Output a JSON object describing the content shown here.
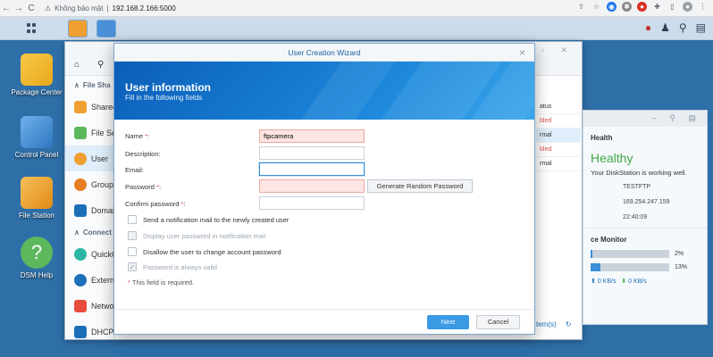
{
  "browser": {
    "security_label": "Không bảo mật",
    "url": "192.168.2.166:5000"
  },
  "desktop": {
    "icons": [
      {
        "label": "Package Center",
        "color": "#f2b634"
      },
      {
        "label": "Control Panel",
        "color": "#4a90d9"
      },
      {
        "label": "File Station",
        "color": "#f0a030"
      },
      {
        "label": "DSM Help",
        "color": "#5cb85c"
      }
    ]
  },
  "control_panel": {
    "sidebar": {
      "file_sharing_header": "File Sha",
      "connectivity_header": "Connect",
      "items": [
        {
          "label": "Shared",
          "color": "#f0a030"
        },
        {
          "label": "File Se",
          "color": "#5cb85c"
        },
        {
          "label": "User",
          "color": "#f0a030"
        },
        {
          "label": "Group",
          "color": "#e67e22"
        },
        {
          "label": "Domai",
          "color": "#1d6fb8"
        },
        {
          "label": "QuickC",
          "color": "#2bb6a3"
        },
        {
          "label": "Extern",
          "color": "#1d6fb8"
        },
        {
          "label": "Netwo",
          "color": "#e74c3c"
        },
        {
          "label": "DHCP Server",
          "color": "#1d6fb8"
        }
      ]
    },
    "table_fragment": [
      "atus",
      "bled",
      "rmal",
      "bled",
      "rmal"
    ],
    "footer_fragment": "tem(s)"
  },
  "health_widget": {
    "title": "Health",
    "status": "Healthy",
    "message": "Your DiskStation is working well.",
    "server_name": "TESTFTP",
    "ip": "169.254.247.159",
    "time": "22:40:09",
    "resource_title": "ce Monitor",
    "cpu_value": "2%",
    "cpu_fraction": 0.02,
    "ram_value": "13%",
    "ram_fraction": 0.13,
    "upload": "0 KB/s",
    "download": "0 KB/s"
  },
  "dialog": {
    "title": "User Creation Wizard",
    "heading": "User information",
    "subheading": "Fill in the following fields",
    "fields": {
      "name_label": "Name",
      "name_value": "ftpcamera",
      "description_label": "Description:",
      "email_label": "Email:",
      "password_label": "Password",
      "confirm_label": "Confirm password"
    },
    "generate_button": "Generate Random Password",
    "checkboxes": [
      {
        "label": "Send a notification mail to the newly created user",
        "checked": false,
        "disabled": false
      },
      {
        "label": "Display user password in notification mail",
        "checked": false,
        "disabled": true
      },
      {
        "label": "Disallow the user to change account password",
        "checked": false,
        "disabled": false
      },
      {
        "label": "Password is always valid",
        "checked": true,
        "disabled": true
      }
    ],
    "required_note": "This field is required.",
    "next_button": "Next",
    "cancel_button": "Cancel"
  }
}
